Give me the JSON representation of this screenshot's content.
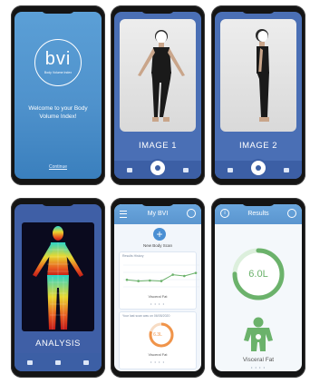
{
  "welcome": {
    "logo_text": "bvi",
    "logo_sub": "Body Volume Index",
    "message": "Welcome to your Body Volume Index!",
    "link": "Continue"
  },
  "capture": {
    "image1_label": "IMAGE 1",
    "image2_label": "IMAGE 2",
    "bottom_icons": [
      "gallery-icon",
      "camera-icon",
      "user-icon"
    ]
  },
  "analysis": {
    "label": "ANALYSIS"
  },
  "my_bvi": {
    "title": "My BVI",
    "new_scan_symbol": "+",
    "new_scan_label": "New Body Scan",
    "history_title": "Results History",
    "history_caption": "Visceral Fat",
    "chart_points": [
      0.35,
      0.3,
      0.32,
      0.3,
      0.55,
      0.5,
      0.62
    ],
    "last_scan_title": "Your last scan was on 06/05/2020",
    "last_value": "6.3L",
    "last_caption": "Visceral Fat",
    "dots": "• • • •"
  },
  "results": {
    "title": "Results",
    "info_symbol": "i",
    "value": "6.0L",
    "gauge_fraction": 0.75,
    "caption": "Visceral Fat",
    "dots": "• • • •"
  },
  "colors": {
    "brand_blue": "#4f92cc",
    "deep_blue": "#3c5fa5",
    "green": "#6bb26b",
    "orange": "#f0944a"
  }
}
